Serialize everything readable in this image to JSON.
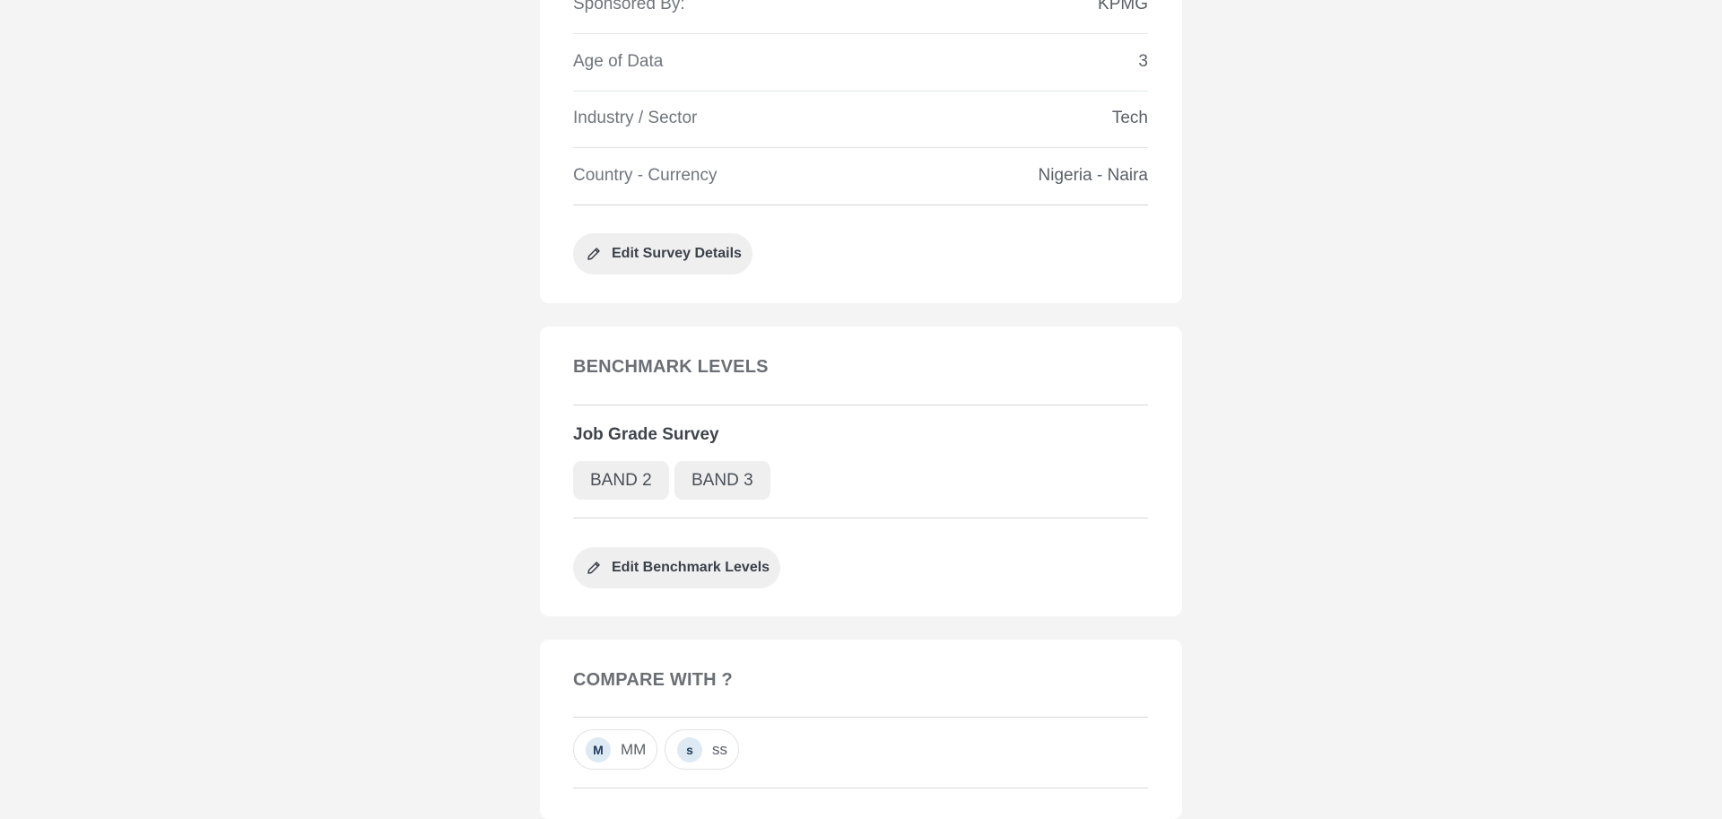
{
  "survey_details": {
    "rows": [
      {
        "label": "Sponsored By:",
        "value": "KPMG"
      },
      {
        "label": "Age of Data",
        "value": "3"
      },
      {
        "label": "Industry / Sector",
        "value": "Tech"
      },
      {
        "label": "Country - Currency",
        "value": "Nigeria - Naira"
      }
    ],
    "edit_button": "Edit Survey Details",
    "edit_icon": "pencil-icon"
  },
  "benchmark_levels": {
    "title": "BENCHMARK LEVELS",
    "group_title": "Job Grade Survey",
    "bands": [
      "BAND 2",
      "BAND 3"
    ],
    "edit_button": "Edit Benchmark Levels",
    "edit_icon": "pencil-icon"
  },
  "compare_with": {
    "title": "COMPARE WITH ?",
    "options": [
      {
        "badge": "M",
        "name": "MM"
      },
      {
        "badge": "s",
        "name": "ss"
      }
    ]
  }
}
